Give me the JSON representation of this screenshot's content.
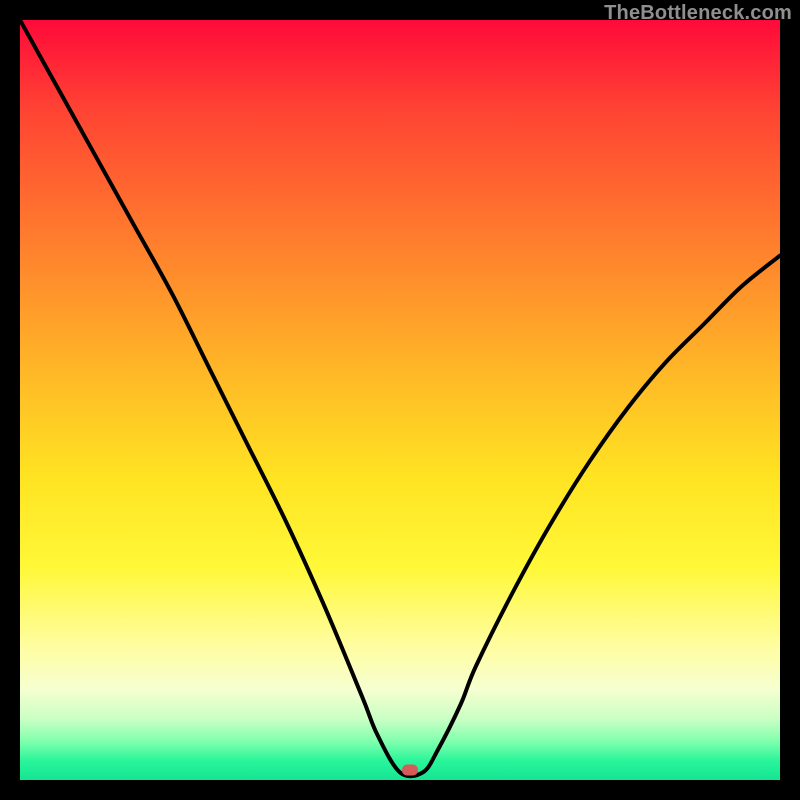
{
  "watermark": "TheBottleneck.com",
  "marker": {
    "x_pct": 51.3,
    "y_pct": 98.7
  },
  "chart_data": {
    "type": "line",
    "title": "",
    "xlabel": "",
    "ylabel": "",
    "xlim": [
      0,
      100
    ],
    "ylim": [
      0,
      100
    ],
    "background_gradient_note": "red (high bottleneck) at top, green (no bottleneck) at bottom",
    "series": [
      {
        "name": "bottleneck-curve",
        "note": "Values estimated from pixel heights; 0 = bottom (green, no bottleneck), 100 = top (red).",
        "x": [
          0,
          5,
          10,
          15,
          20,
          25,
          30,
          35,
          40,
          45,
          47,
          50,
          53,
          55,
          58,
          60,
          65,
          70,
          75,
          80,
          85,
          90,
          95,
          100
        ],
        "y": [
          100,
          91,
          82,
          73,
          64,
          54,
          44,
          34,
          23,
          11,
          6,
          1,
          1,
          4,
          10,
          15,
          25,
          34,
          42,
          49,
          55,
          60,
          65,
          69
        ]
      }
    ],
    "marker_point": {
      "x": 51.3,
      "y": 1.3
    }
  }
}
